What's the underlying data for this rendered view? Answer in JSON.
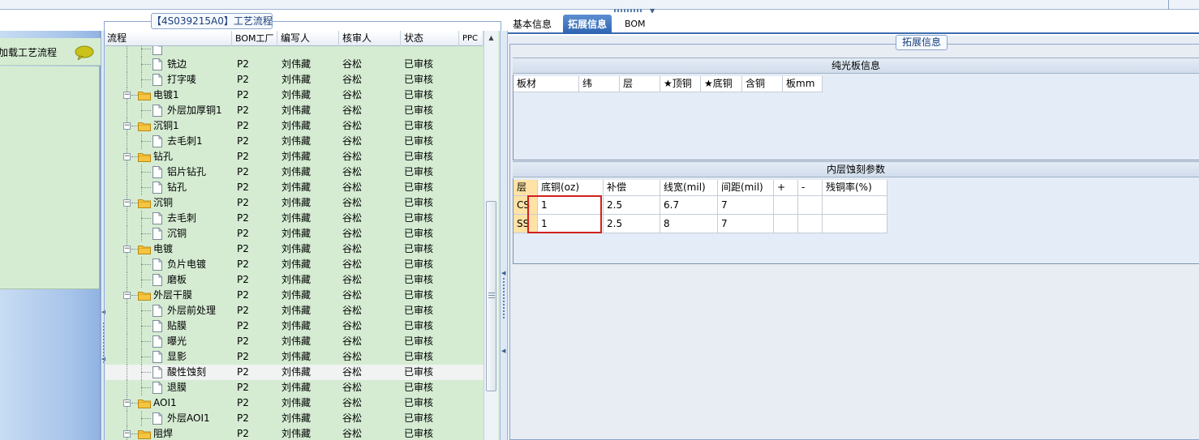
{
  "left_panel": {
    "item_label": "加载工艺流程",
    "bubble_icon": "speech-bubble-icon"
  },
  "flow_panel": {
    "title": "【4S039215A0】工艺流程",
    "columns": [
      "流程",
      "BOM工厂",
      "编写人",
      "核审人",
      "状态",
      "PPC"
    ],
    "rows": [
      {
        "level": 2,
        "type": "doc",
        "name": "",
        "factory": "",
        "writer": "",
        "reviewer": "",
        "status": "",
        "partial": true
      },
      {
        "level": 2,
        "type": "doc",
        "name": "铣边",
        "factory": "P2",
        "writer": "刘伟藏",
        "reviewer": "谷松",
        "status": "已审核"
      },
      {
        "level": 2,
        "type": "doc",
        "name": "打字唛",
        "factory": "P2",
        "writer": "刘伟藏",
        "reviewer": "谷松",
        "status": "已审核"
      },
      {
        "level": 1,
        "type": "folder",
        "name": "电镀1",
        "factory": "P2",
        "writer": "刘伟藏",
        "reviewer": "谷松",
        "status": "已审核"
      },
      {
        "level": 2,
        "type": "doc",
        "name": "外层加厚铜1",
        "factory": "P2",
        "writer": "刘伟藏",
        "reviewer": "谷松",
        "status": "已审核"
      },
      {
        "level": 1,
        "type": "folder",
        "name": "沉铜1",
        "factory": "P2",
        "writer": "刘伟藏",
        "reviewer": "谷松",
        "status": "已审核"
      },
      {
        "level": 2,
        "type": "doc",
        "name": "去毛刺1",
        "factory": "P2",
        "writer": "刘伟藏",
        "reviewer": "谷松",
        "status": "已审核"
      },
      {
        "level": 1,
        "type": "folder",
        "name": "钻孔",
        "factory": "P2",
        "writer": "刘伟藏",
        "reviewer": "谷松",
        "status": "已审核"
      },
      {
        "level": 2,
        "type": "doc",
        "name": "铝片钻孔",
        "factory": "P2",
        "writer": "刘伟藏",
        "reviewer": "谷松",
        "status": "已审核"
      },
      {
        "level": 2,
        "type": "doc",
        "name": "钻孔",
        "factory": "P2",
        "writer": "刘伟藏",
        "reviewer": "谷松",
        "status": "已审核"
      },
      {
        "level": 1,
        "type": "folder",
        "name": "沉铜",
        "factory": "P2",
        "writer": "刘伟藏",
        "reviewer": "谷松",
        "status": "已审核"
      },
      {
        "level": 2,
        "type": "doc",
        "name": "去毛刺",
        "factory": "P2",
        "writer": "刘伟藏",
        "reviewer": "谷松",
        "status": "已审核"
      },
      {
        "level": 2,
        "type": "doc",
        "name": "沉铜",
        "factory": "P2",
        "writer": "刘伟藏",
        "reviewer": "谷松",
        "status": "已审核"
      },
      {
        "level": 1,
        "type": "folder",
        "name": "电镀",
        "factory": "P2",
        "writer": "刘伟藏",
        "reviewer": "谷松",
        "status": "已审核"
      },
      {
        "level": 2,
        "type": "doc",
        "name": "负片电镀",
        "factory": "P2",
        "writer": "刘伟藏",
        "reviewer": "谷松",
        "status": "已审核"
      },
      {
        "level": 2,
        "type": "doc",
        "name": "磨板",
        "factory": "P2",
        "writer": "刘伟藏",
        "reviewer": "谷松",
        "status": "已审核"
      },
      {
        "level": 1,
        "type": "folder",
        "name": "外层干膜",
        "factory": "P2",
        "writer": "刘伟藏",
        "reviewer": "谷松",
        "status": "已审核"
      },
      {
        "level": 2,
        "type": "doc",
        "name": "外层前处理",
        "factory": "P2",
        "writer": "刘伟藏",
        "reviewer": "谷松",
        "status": "已审核"
      },
      {
        "level": 2,
        "type": "doc",
        "name": "贴膜",
        "factory": "P2",
        "writer": "刘伟藏",
        "reviewer": "谷松",
        "status": "已审核"
      },
      {
        "level": 2,
        "type": "doc",
        "name": "曝光",
        "factory": "P2",
        "writer": "刘伟藏",
        "reviewer": "谷松",
        "status": "已审核"
      },
      {
        "level": 2,
        "type": "doc",
        "name": "显影",
        "factory": "P2",
        "writer": "刘伟藏",
        "reviewer": "谷松",
        "status": "已审核"
      },
      {
        "level": 2,
        "type": "doc",
        "name": "酸性蚀刻",
        "factory": "P2",
        "writer": "刘伟藏",
        "reviewer": "谷松",
        "status": "已审核",
        "selected": true
      },
      {
        "level": 2,
        "type": "doc",
        "name": "退膜",
        "factory": "P2",
        "writer": "刘伟藏",
        "reviewer": "谷松",
        "status": "已审核"
      },
      {
        "level": 1,
        "type": "folder",
        "name": "AOI1",
        "factory": "P2",
        "writer": "刘伟藏",
        "reviewer": "谷松",
        "status": "已审核"
      },
      {
        "level": 2,
        "type": "doc",
        "name": "外层AOI1",
        "factory": "P2",
        "writer": "刘伟藏",
        "reviewer": "谷松",
        "status": "已审核"
      },
      {
        "level": 1,
        "type": "folder",
        "name": "阻焊",
        "factory": "P2",
        "writer": "刘伟藏",
        "reviewer": "谷松",
        "status": "已审核"
      }
    ]
  },
  "tabs": [
    {
      "label": "基本信息",
      "active": false
    },
    {
      "label": "拓展信息",
      "active": true
    },
    {
      "label": "BOM",
      "active": false
    }
  ],
  "ext_info": {
    "group_title": "拓展信息",
    "bare_board": {
      "title": "纯光板信息",
      "columns": [
        "板材",
        "纬",
        "层",
        "★顶铜",
        "★底铜",
        "含铜",
        "板mm"
      ]
    },
    "inner_etch": {
      "title": "内层蚀刻参数",
      "columns": [
        "层",
        "底铜(oz)",
        "补偿",
        "线宽(mil)",
        "间距(mil)",
        "+",
        "-",
        "残铜率(%)"
      ],
      "rows": [
        [
          "CS",
          "1",
          "2.5",
          "6.7",
          "7",
          "",
          "",
          ""
        ],
        [
          "SS",
          "1",
          "2.5",
          "8",
          "7",
          "",
          "",
          ""
        ]
      ]
    }
  },
  "colors": {
    "tree_bg": "#d5ecd3",
    "tab_active": "#2c62b0",
    "highlight_box": "#d21f1f",
    "row_header": "#ffe2a6"
  }
}
